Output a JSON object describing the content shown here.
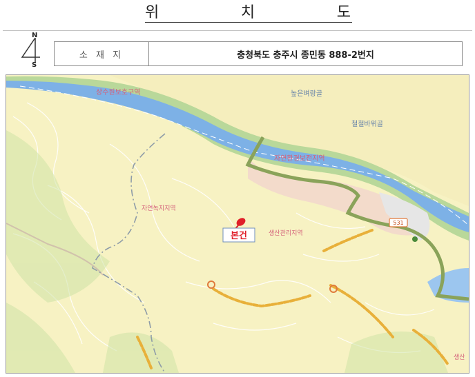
{
  "page": {
    "title_chars": [
      "위",
      "치",
      "도"
    ]
  },
  "north_arrow": {
    "north": "N",
    "south": "S"
  },
  "location": {
    "label": "소 재 지",
    "address": "충청북도 충주시 종민동 888-2번지"
  },
  "map": {
    "labels": {
      "zone_top": "상수원보호구역",
      "place_1": "높은벼랑골",
      "place_2": "철철바위골",
      "zone_river": "자연환경보전지역",
      "zone_green": "자연녹지지역",
      "zone_management": "생산관리지역",
      "road_number": "531",
      "corner_partial": "생산",
      "subject_marker": "본건"
    },
    "colors": {
      "land": "#f7f2c3",
      "river": "#7db1e6",
      "river_bank": "#b9d89a",
      "route": "#8aa35a",
      "zone_text": "#d4607a",
      "subject_text": "#e0202a",
      "label_text": "#5d7ca8",
      "trail": "#e8b03a"
    },
    "icons": [
      "location-pin-icon",
      "north-arrow-icon",
      "route-shield-icon"
    ]
  }
}
